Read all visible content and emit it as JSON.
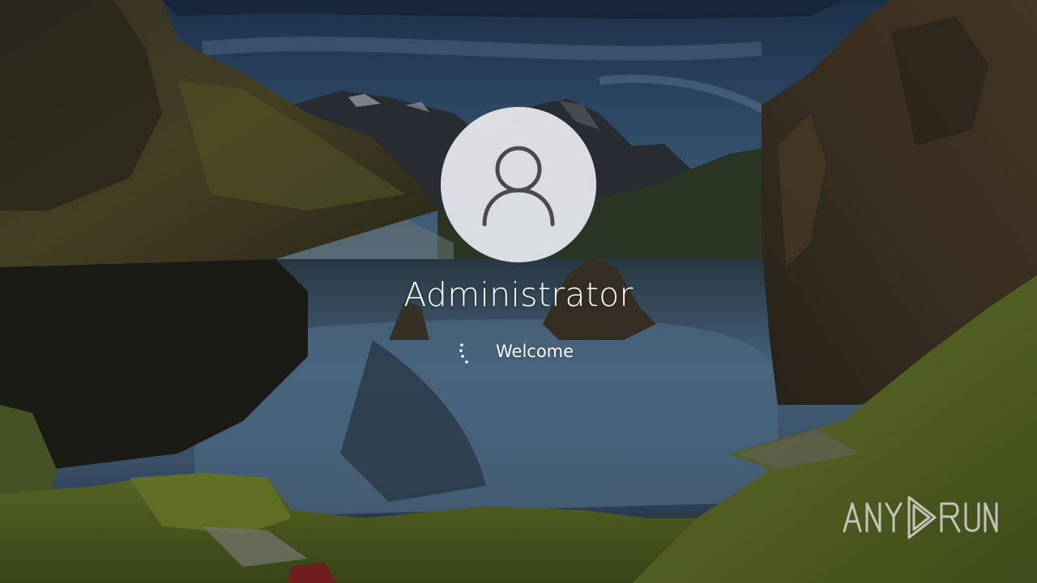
{
  "lock_screen": {
    "user": {
      "name": "Administrator",
      "avatar_icon": "user-silhouette-icon"
    },
    "status": {
      "text": "Welcome",
      "indicator": "loading-spinner-icon"
    },
    "watermark": {
      "brand_text": "ANY RUN",
      "logo_icon": "play-triangle-icon"
    },
    "colors": {
      "text": "#ffffff",
      "avatar_bg": "#e2e4e8",
      "avatar_icon": "#4a4a4e",
      "watermark": "#d8d8d8"
    }
  }
}
